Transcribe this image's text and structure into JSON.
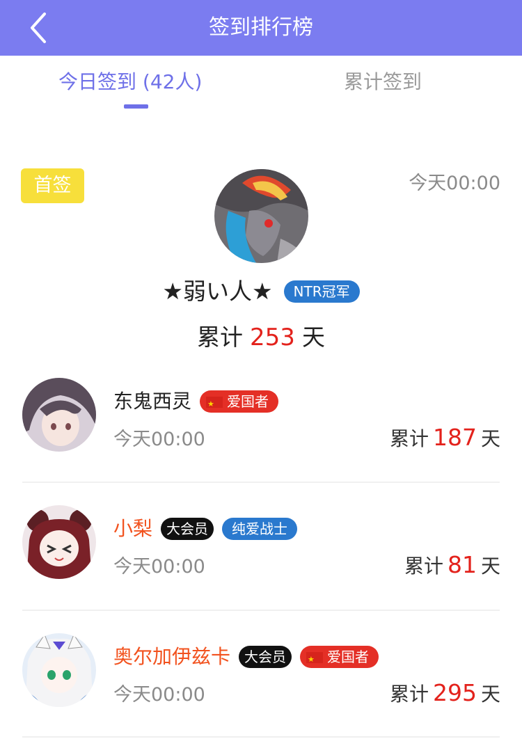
{
  "header": {
    "title": "签到排行榜"
  },
  "tabs": [
    {
      "label": "今日签到 (42人)",
      "active": true
    },
    {
      "label": "累计签到",
      "active": false
    }
  ],
  "colors": {
    "accent": "#6e70e8",
    "header_bg": "#7b7cf0",
    "highlight_red": "#e3221c",
    "orange_name": "#f2521e"
  },
  "first": {
    "badge": "首签",
    "time": "今天00:00",
    "name": "★弱い人★",
    "tag": "NTR冠军",
    "total_prefix": "累计",
    "total_days": "253",
    "total_suffix": "天"
  },
  "list": [
    {
      "name": "东鬼西灵",
      "tags": [
        {
          "type": "red",
          "icon": "china-flag-icon",
          "label": "爱国者"
        }
      ],
      "time": "今天00:00",
      "total_prefix": "累计",
      "total_days": "187",
      "total_suffix": "天"
    },
    {
      "name": "小梨",
      "tags": [
        {
          "type": "black",
          "label": "大会员"
        },
        {
          "type": "blue",
          "label": "纯爱战士"
        }
      ],
      "time": "今天00:00",
      "total_prefix": "累计",
      "total_days": "81",
      "total_suffix": "天"
    },
    {
      "name": "奥尔加伊兹卡",
      "tags": [
        {
          "type": "black",
          "label": "大会员"
        },
        {
          "type": "red",
          "icon": "china-flag-icon",
          "label": "爱国者"
        }
      ],
      "time": "今天00:00",
      "total_prefix": "累计",
      "total_days": "295",
      "total_suffix": "天"
    }
  ]
}
